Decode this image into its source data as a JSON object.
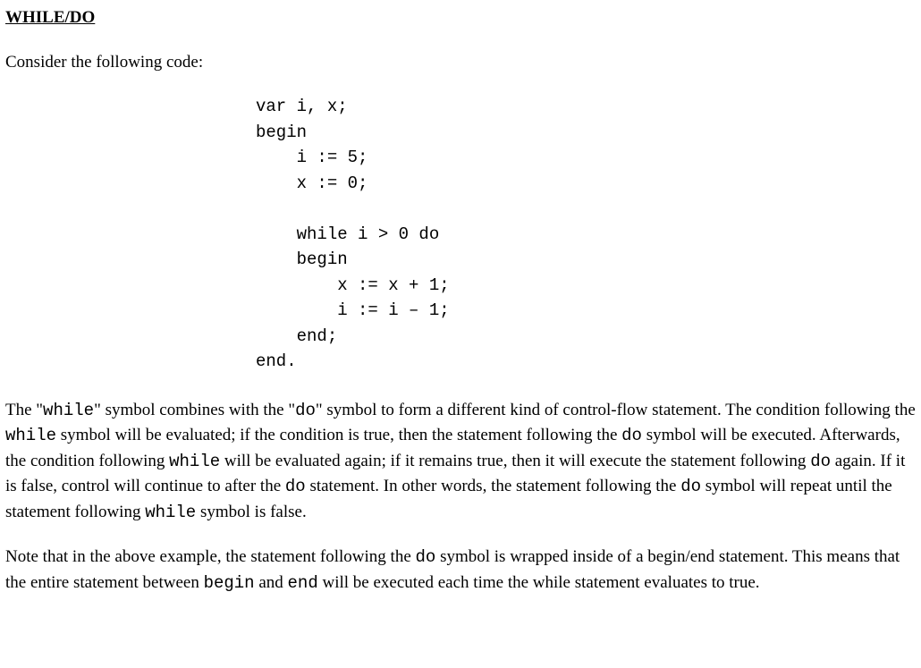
{
  "heading": "WHILE/DO",
  "intro": "Consider the following code:",
  "code": "var i, x;\nbegin\n    i := 5;\n    x := 0;\n\n    while i > 0 do\n    begin\n        x := x + 1;\n        i := i – 1;\n    end;\nend.",
  "p1": {
    "t1": "The \"",
    "c1": "while",
    "t2": "\" symbol combines with the \"",
    "c2": "do",
    "t3": "\" symbol to form a different kind of control-flow statement.  The condition following the ",
    "c3": "while",
    "t4": " symbol will be evaluated; if the condition is true, then the statement following the ",
    "c4": "do",
    "t5": " symbol will be executed.  Afterwards, the condition following ",
    "c5": "while",
    "t6": " will be evaluated again; if it remains true, then it will execute the statement following ",
    "c6": "do",
    "t7": " again.  If it is false, control will continue to after the ",
    "c7": "do",
    "t8": " statement.  In other words, the statement following the ",
    "c8": "do",
    "t9": " symbol will repeat until the statement following ",
    "c9": "while",
    "t10": " symbol is false."
  },
  "p2": {
    "t1": "Note that in the above example, the statement following the ",
    "c1": "do",
    "t2": " symbol is wrapped inside of a begin/end statement.  This means that the entire statement between ",
    "c2": "begin",
    "t3": " and ",
    "c3": "end",
    "t4": " will be executed each time the while statement evaluates to true."
  }
}
